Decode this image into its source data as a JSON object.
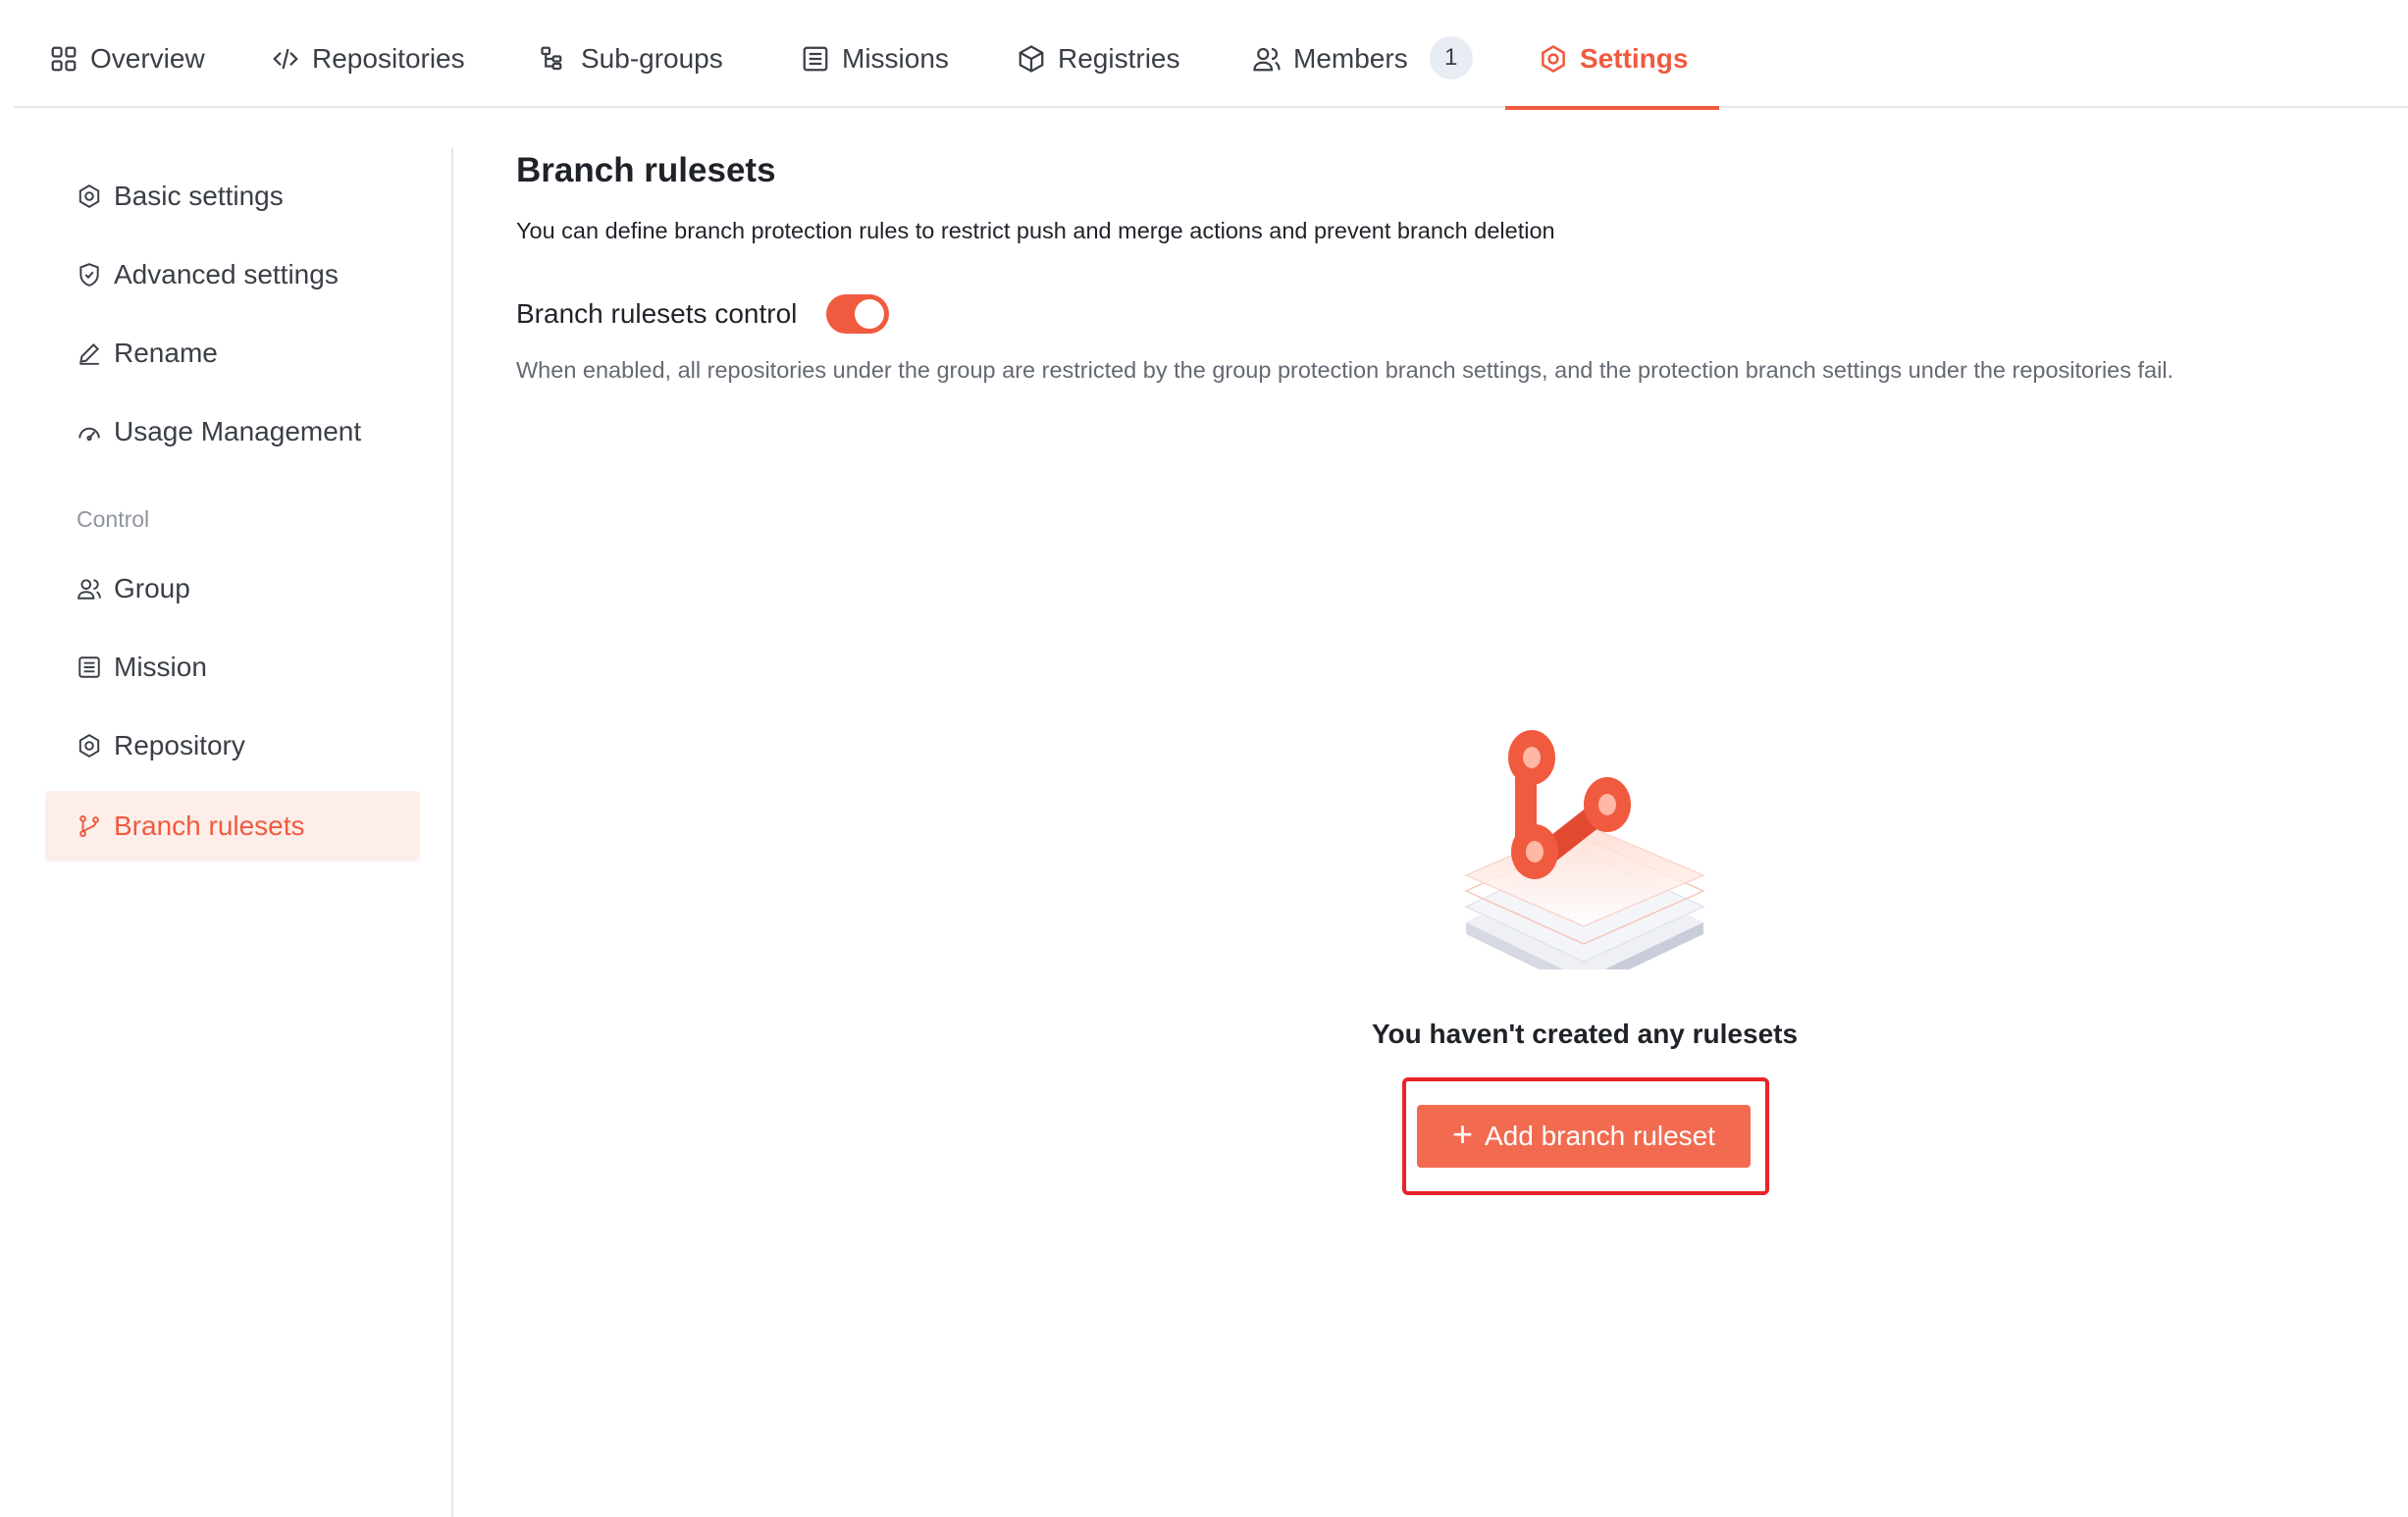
{
  "tabs": [
    {
      "label": "Overview",
      "icon": "grid-icon"
    },
    {
      "label": "Repositories",
      "icon": "code-icon"
    },
    {
      "label": "Sub-groups",
      "icon": "tree-icon"
    },
    {
      "label": "Missions",
      "icon": "list-icon"
    },
    {
      "label": "Registries",
      "icon": "box-icon"
    },
    {
      "label": "Members",
      "icon": "users-icon",
      "badge": "1"
    },
    {
      "label": "Settings",
      "icon": "gear-icon",
      "active": true
    }
  ],
  "sidebar": {
    "items": [
      {
        "label": "Basic settings",
        "icon": "gear-icon"
      },
      {
        "label": "Advanced settings",
        "icon": "shield-icon"
      },
      {
        "label": "Rename",
        "icon": "pencil-icon"
      },
      {
        "label": "Usage Management",
        "icon": "gauge-icon"
      }
    ],
    "group_label": "Control",
    "control_items": [
      {
        "label": "Group",
        "icon": "users-icon"
      },
      {
        "label": "Mission",
        "icon": "list-icon"
      },
      {
        "label": "Repository",
        "icon": "gear-icon"
      },
      {
        "label": "Branch rulesets",
        "icon": "branch-icon",
        "active": true
      }
    ]
  },
  "main": {
    "title": "Branch rulesets",
    "description": "You can define branch protection rules to restrict push and merge actions and prevent branch deletion",
    "control_label": "Branch rulesets control",
    "control_enabled": true,
    "control_help": "When enabled, all repositories under the group are restricted by the group protection branch settings, and the protection branch settings under the repositories fail.",
    "empty_text": "You haven't created any rulesets",
    "add_button": {
      "icon": "+",
      "label": "Add branch ruleset"
    }
  },
  "colors": {
    "accent": "#f05a3f",
    "button": "#f26b50",
    "active_bg": "#fdeeea",
    "highlight": "#e8232a"
  }
}
